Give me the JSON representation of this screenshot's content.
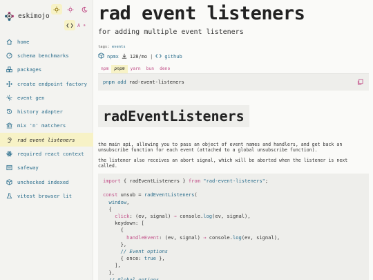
{
  "sidebar": {
    "brand": "eskimojo",
    "items": [
      {
        "label": "home",
        "icon": "home-icon"
      },
      {
        "label": "schema benchmarks",
        "icon": "gauge-icon"
      },
      {
        "label": "packages",
        "icon": "packages-icon"
      },
      {
        "label": "create endpoint factory",
        "icon": "move-icon"
      },
      {
        "label": "event gen",
        "icon": "sparkle-icon"
      },
      {
        "label": "history adapter",
        "icon": "history-icon"
      },
      {
        "label": "mix 'n' matchers",
        "icon": "bank-icon"
      },
      {
        "label": "rad event listeners",
        "icon": "ear-icon",
        "active": true
      },
      {
        "label": "required react context",
        "icon": "atom-icon"
      },
      {
        "label": "safeway",
        "icon": "browser-icon"
      },
      {
        "label": "unchecked indexed",
        "icon": "box-icon"
      },
      {
        "label": "vitest browser lit",
        "icon": "flask-icon"
      }
    ]
  },
  "page": {
    "title": "rad event listeners",
    "subtitle": "for adding multiple event listeners",
    "tags_label": "tags:",
    "tag": "events",
    "npmx": "npmx",
    "downloads": "128/mo",
    "separator": "|",
    "github": "github"
  },
  "package_managers": {
    "tabs": [
      "npm",
      "pnpm",
      "yarn",
      "bun",
      "deno"
    ],
    "active": "pnpm",
    "command_prefix": "pnpm add",
    "package": "rad-event-listeners"
  },
  "section": {
    "heading": "radEventListeners",
    "p1": "the main api, allowing you to pass an object of event names and handlers, and get back an unsubscribe function for each event (attached to a global unsubscribe function).",
    "p2": "the listener also receives an abort signal, which will be aborted when the listener is next called."
  },
  "colors": {
    "accent_pink": "#c04c86",
    "accent_teal": "#2a6d8c",
    "highlight": "#f7f2c6"
  }
}
